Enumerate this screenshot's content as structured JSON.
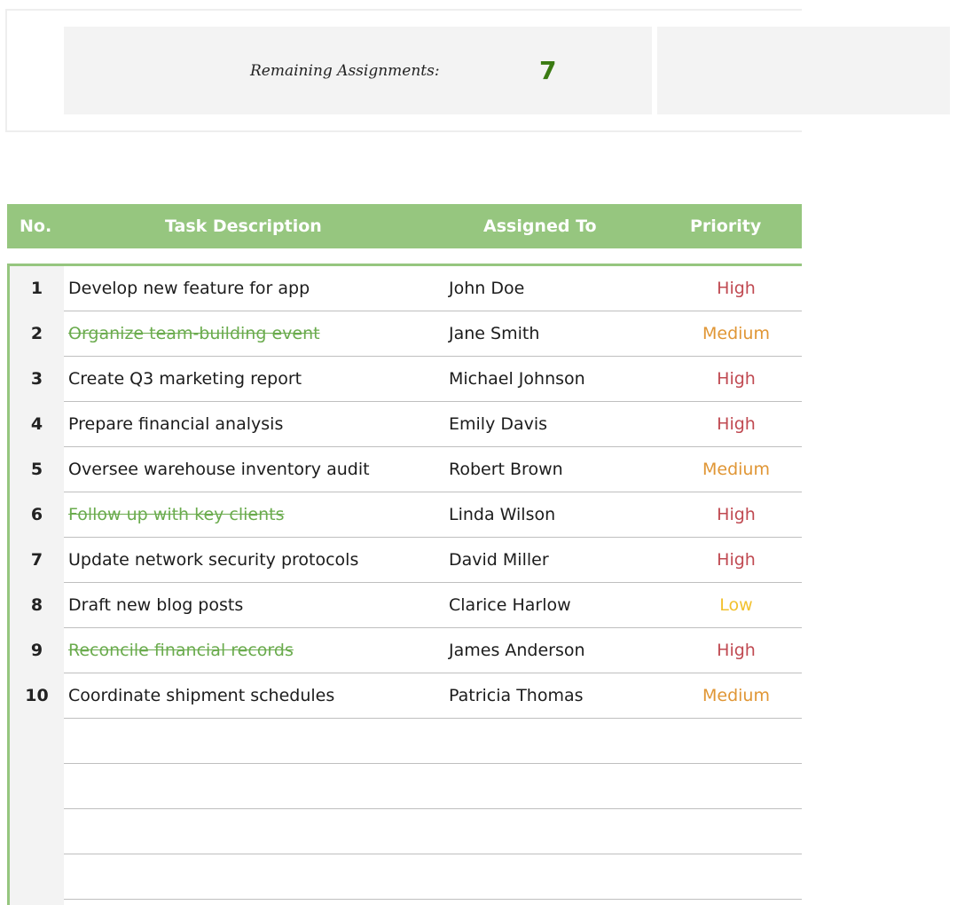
{
  "summary": {
    "label": "Remaining Assignments:",
    "count": "7"
  },
  "header": {
    "no": "No.",
    "task": "Task Description",
    "assigned": "Assigned To",
    "priority": "Priority"
  },
  "rows": [
    {
      "no": "1",
      "task": "Develop new feature for app",
      "assignee": "John Doe",
      "priority": "High",
      "done": false
    },
    {
      "no": "2",
      "task": "Organize team-building event",
      "assignee": "Jane Smith",
      "priority": "Medium",
      "done": true
    },
    {
      "no": "3",
      "task": "Create Q3 marketing report",
      "assignee": "Michael Johnson",
      "priority": "High",
      "done": false
    },
    {
      "no": "4",
      "task": "Prepare financial analysis",
      "assignee": "Emily Davis",
      "priority": "High",
      "done": false
    },
    {
      "no": "5",
      "task": "Oversee warehouse inventory audit",
      "assignee": "Robert Brown",
      "priority": "Medium",
      "done": false
    },
    {
      "no": "6",
      "task": "Follow up with key clients",
      "assignee": "Linda Wilson",
      "priority": "High",
      "done": true
    },
    {
      "no": "7",
      "task": "Update network security protocols",
      "assignee": "David Miller",
      "priority": "High",
      "done": false
    },
    {
      "no": "8",
      "task": "Draft new blog posts",
      "assignee": "Clarice Harlow",
      "priority": "Low",
      "done": false
    },
    {
      "no": "9",
      "task": "Reconcile financial records",
      "assignee": "James Anderson",
      "priority": "High",
      "done": true
    },
    {
      "no": "10",
      "task": "Coordinate shipment schedules",
      "assignee": "Patricia Thomas",
      "priority": "Medium",
      "done": false
    }
  ],
  "colors": {
    "header": "#96c67f",
    "done_task": "#6aab4d",
    "high": "#c04a52",
    "medium": "#e09635",
    "low": "#f2c12e",
    "count": "#3a7a12"
  }
}
